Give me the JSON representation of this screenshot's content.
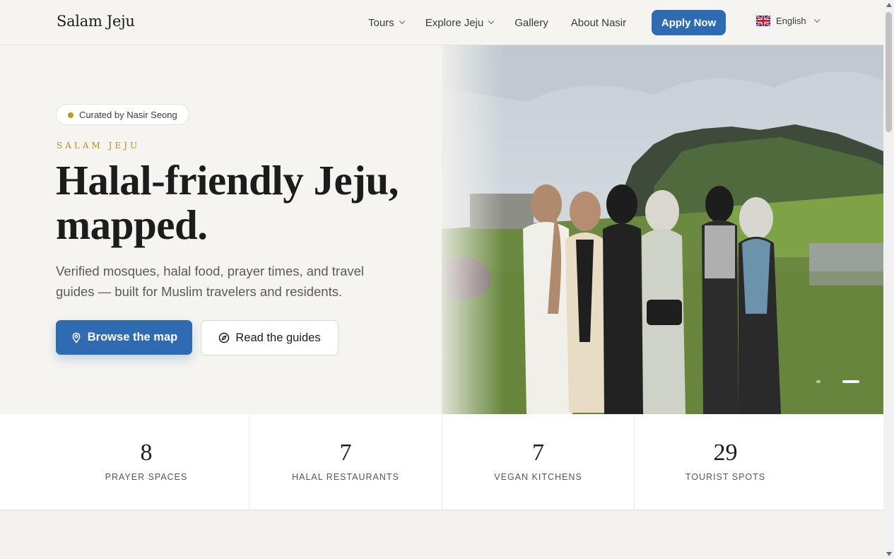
{
  "header": {
    "logo": "Salam Jeju",
    "nav": [
      {
        "label": "Tours",
        "dropdown": true
      },
      {
        "label": "Explore Jeju",
        "dropdown": true
      },
      {
        "label": "Gallery",
        "dropdown": false
      },
      {
        "label": "About Nasir",
        "dropdown": false
      }
    ],
    "apply_label": "Apply Now",
    "language": "English"
  },
  "hero": {
    "badge": "Curated by Nasir Seong",
    "eyebrow": "SALAM JEJU",
    "headline": "Halal-friendly Jeju, mapped.",
    "lede": "Verified mosques, halal food, prayer times, and travel guides — built for Muslim travelers and residents.",
    "primary_cta": "Browse the map",
    "secondary_cta": "Read the guides",
    "slides_total": 2,
    "active_slide": 2
  },
  "stats": [
    {
      "value": "8",
      "label": "PRAYER SPACES"
    },
    {
      "value": "7",
      "label": "HALAL RESTAURANTS"
    },
    {
      "value": "7",
      "label": "VEGAN KITCHENS"
    },
    {
      "value": "29",
      "label": "TOURIST SPOTS"
    }
  ],
  "colors": {
    "accent": "#2f6bb3",
    "gold": "#b8921e",
    "background": "#f5f4f0"
  }
}
